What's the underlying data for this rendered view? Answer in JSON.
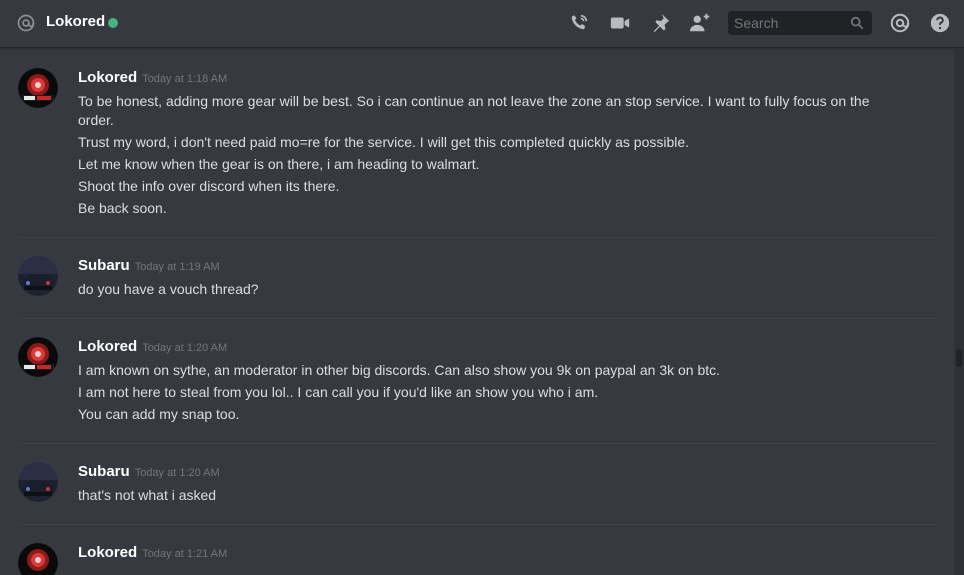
{
  "header": {
    "channel_name": "Lokored",
    "status_color": "#43b581",
    "icons": [
      "at-icon",
      "phone-call-icon",
      "video-camera-icon",
      "pin-icon",
      "add-friend-icon",
      "mention-icon",
      "help-icon"
    ],
    "search_placeholder": "Search"
  },
  "messages": [
    {
      "author": "Lokored",
      "timestamp": "Today at 1:18 AM",
      "lines": [
        "To be honest, adding more gear will be best. So i can continue an not leave the zone an stop service. I want to fully focus on the",
        "order.",
        "Trust my word, i don't need paid mo=re for the service. I will get this completed quickly as possible.",
        "Let me know when the gear is on there, i am heading to walmart.",
        "Shoot the info over discord when its there.",
        "Be back soon."
      ]
    },
    {
      "author": "Subaru",
      "timestamp": "Today at 1:19 AM",
      "lines": [
        "do you have a vouch thread?"
      ]
    },
    {
      "author": "Lokored",
      "timestamp": "Today at 1:20 AM",
      "lines": [
        "I am known on sythe, an moderator in other big discords. Can also show you 9k on paypal an 3k on btc.",
        "I am not here to steal from you lol.. I can call you if you'd like an show you who i am.",
        "You can add my snap too."
      ]
    },
    {
      "author": "Subaru",
      "timestamp": "Today at 1:20 AM",
      "lines": [
        "that's not what i asked"
      ]
    },
    {
      "author": "Lokored",
      "timestamp": "Today at 1:21 AM",
      "lines": []
    }
  ]
}
